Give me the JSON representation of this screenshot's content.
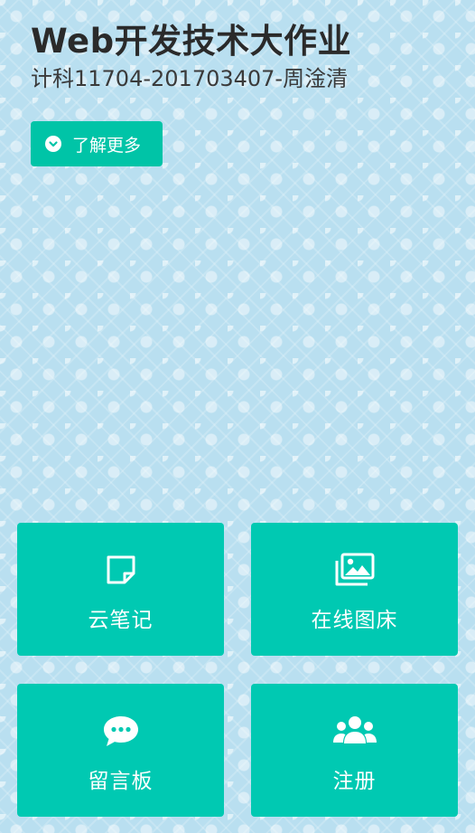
{
  "header": {
    "title": "Web开发技术大作业",
    "subtitle": "计科11704-201703407-周淦清"
  },
  "learn_more": {
    "label": "了解更多",
    "icon": "chevron-down-circle-icon"
  },
  "tiles": [
    {
      "label": "云笔记",
      "icon": "note-icon"
    },
    {
      "label": "在线图床",
      "icon": "images-icon"
    },
    {
      "label": "留言板",
      "icon": "chat-bubble-icon"
    },
    {
      "label": "注册",
      "icon": "users-icon"
    }
  ],
  "colors": {
    "background": "#b9dff0",
    "accent": "#00c4a7",
    "tile": "#00c9b2",
    "text_on_accent": "#ffffff"
  }
}
